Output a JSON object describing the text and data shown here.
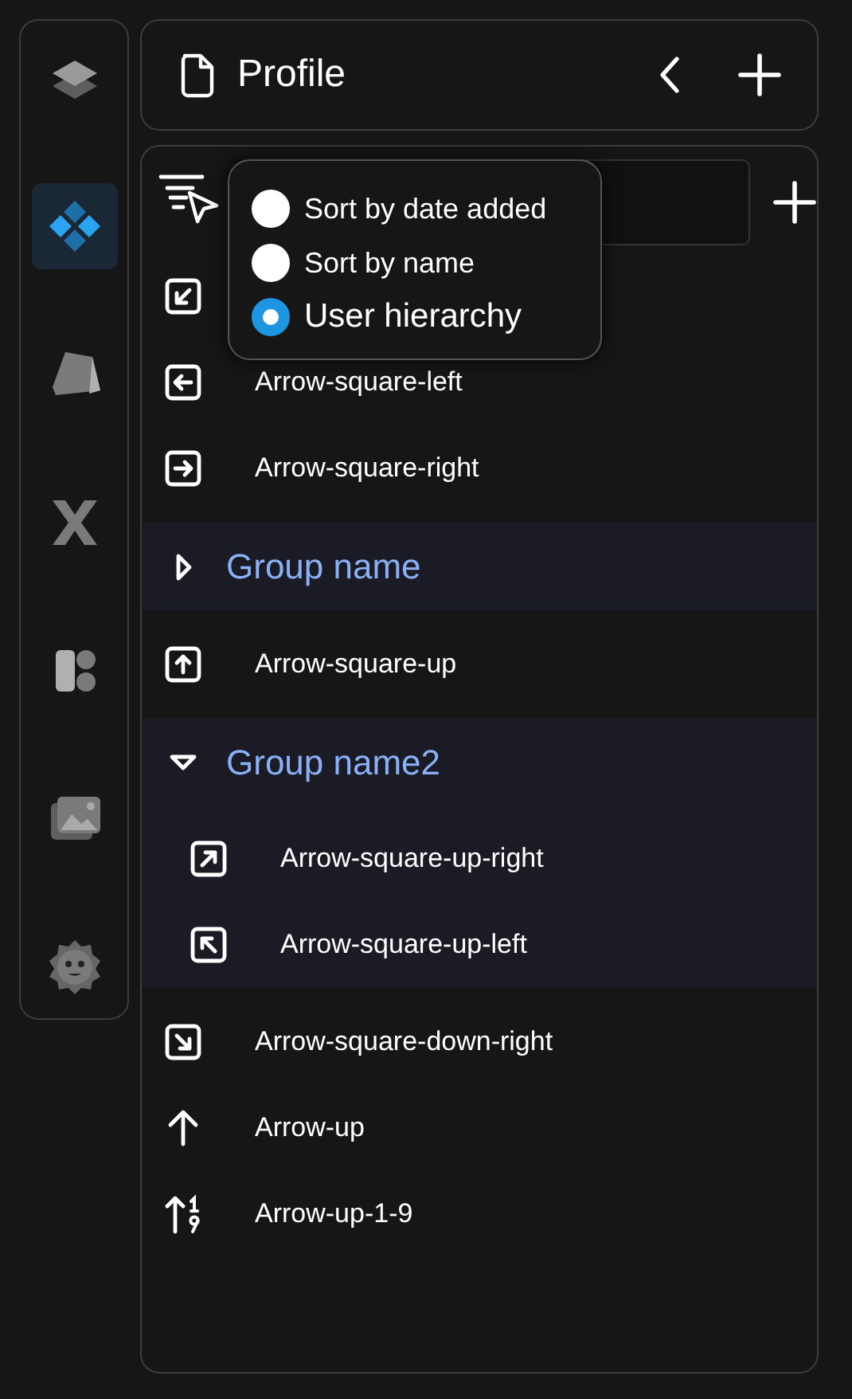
{
  "sidebar": {
    "items": [
      {
        "kind": "layers",
        "selected": false
      },
      {
        "kind": "diamonds",
        "selected": true
      },
      {
        "kind": "prism",
        "selected": false
      },
      {
        "kind": "x",
        "selected": false
      },
      {
        "kind": "blocks",
        "selected": false
      },
      {
        "kind": "images",
        "selected": false
      },
      {
        "kind": "face",
        "selected": false
      }
    ]
  },
  "header": {
    "title": "Profile"
  },
  "sort_menu": {
    "options": [
      {
        "label": "Sort by date added",
        "selected": false
      },
      {
        "label": "Sort by name",
        "selected": false
      },
      {
        "label": "User hierarchy",
        "selected": true
      }
    ]
  },
  "list": {
    "items": [
      {
        "kind": "downleft"
      },
      {
        "kind": "left",
        "label": "Arrow-square-left"
      },
      {
        "kind": "right",
        "label": "Arrow-square-right"
      },
      {
        "kind": "group",
        "label": "Group name",
        "expanded": false
      },
      {
        "kind": "up",
        "label": "Arrow-square-up"
      },
      {
        "kind": "group",
        "label": "Group name2",
        "expanded": true,
        "children": [
          {
            "kind": "upright",
            "label": "Arrow-square-up-right"
          },
          {
            "kind": "upleft",
            "label": "Arrow-square-up-left"
          }
        ]
      },
      {
        "kind": "downright",
        "label": "Arrow-square-down-right"
      },
      {
        "kind": "arrowup",
        "label": "Arrow-up"
      },
      {
        "kind": "sortup",
        "label": "Arrow-up-1-9"
      }
    ]
  }
}
